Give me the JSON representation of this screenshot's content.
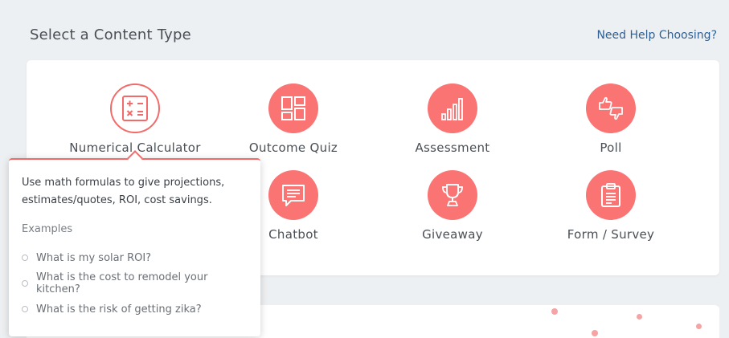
{
  "header": {
    "title": "Select a Content Type",
    "help_link": "Need Help Choosing?"
  },
  "content_types": [
    {
      "label": "Numerical Calculator",
      "icon": "calculator-icon",
      "selected": true
    },
    {
      "label": "Outcome Quiz",
      "icon": "grid-layout-icon"
    },
    {
      "label": "Assessment",
      "icon": "bar-chart-icon"
    },
    {
      "label": "Poll",
      "icon": "thumbs-up-down-icon"
    },
    {
      "label": "Chatbot",
      "icon": "chat-bubble-icon"
    },
    {
      "label": "Giveaway",
      "icon": "trophy-icon"
    },
    {
      "label": "Form / Survey",
      "icon": "clipboard-icon"
    }
  ],
  "tooltip": {
    "description": "Use math formulas to give projections, estimates/quotes, ROI, cost savings.",
    "examples_title": "Examples",
    "examples": [
      "What is my solar ROI?",
      "What is the cost to remodel your kitchen?",
      "What is the risk of getting zika?"
    ]
  },
  "colors": {
    "accent": "#fb7474",
    "accent_border": "#f26b6b",
    "link": "#2f5f93",
    "background": "#edf0f2"
  }
}
